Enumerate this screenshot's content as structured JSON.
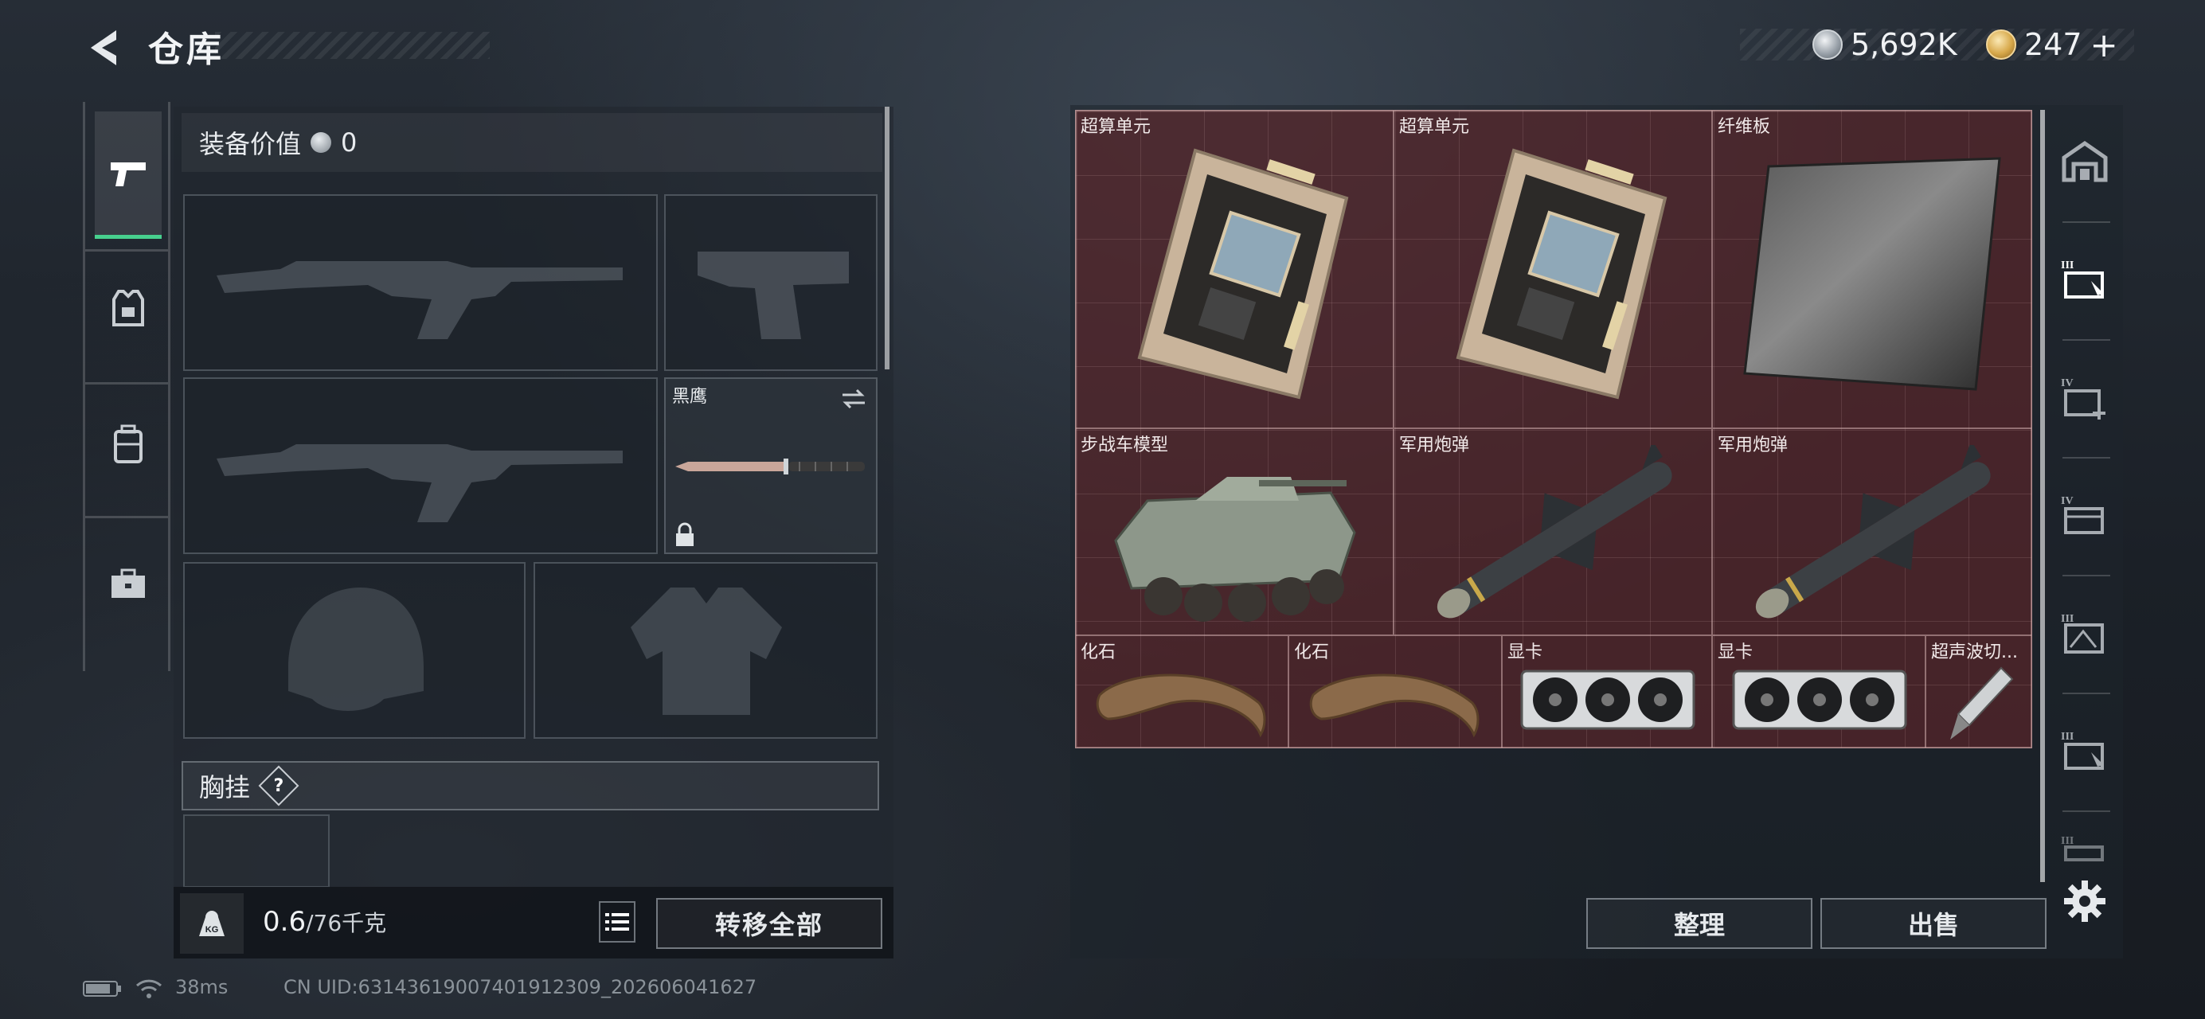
{
  "header": {
    "title": "仓库",
    "currency_silver": "5,692K",
    "currency_gold": "247",
    "currency_gold_add": "+"
  },
  "loadout": {
    "equipment_value_label": "装备价值",
    "equipment_value": "0",
    "melee_label": "黑鹰",
    "chest_rig_label": "胸挂",
    "chest_rig_help": "?",
    "weight_current": "0.6",
    "weight_max": "/76千克",
    "transfer_all": "转移全部"
  },
  "stash": {
    "items": [
      {
        "label": "超算单元"
      },
      {
        "label": "超算单元"
      },
      {
        "label": "纤维板"
      },
      {
        "label": "步战车模型"
      },
      {
        "label": "军用炮弹"
      },
      {
        "label": "军用炮弹"
      },
      {
        "label": "化石"
      },
      {
        "label": "化石"
      },
      {
        "label": "显卡"
      },
      {
        "label": "显卡"
      },
      {
        "label": "超声波切..."
      }
    ],
    "sort_label": "整理",
    "sell_label": "出售",
    "tab_roman": [
      "III",
      "IV",
      "IV",
      "III",
      "III",
      "III"
    ]
  },
  "status_bar": {
    "ping": "38ms",
    "uid": "CN UID:6314361900740191230​9_202606041627"
  },
  "colors": {
    "accent_green": "#47d08e",
    "stash_red": "#6a2629"
  }
}
